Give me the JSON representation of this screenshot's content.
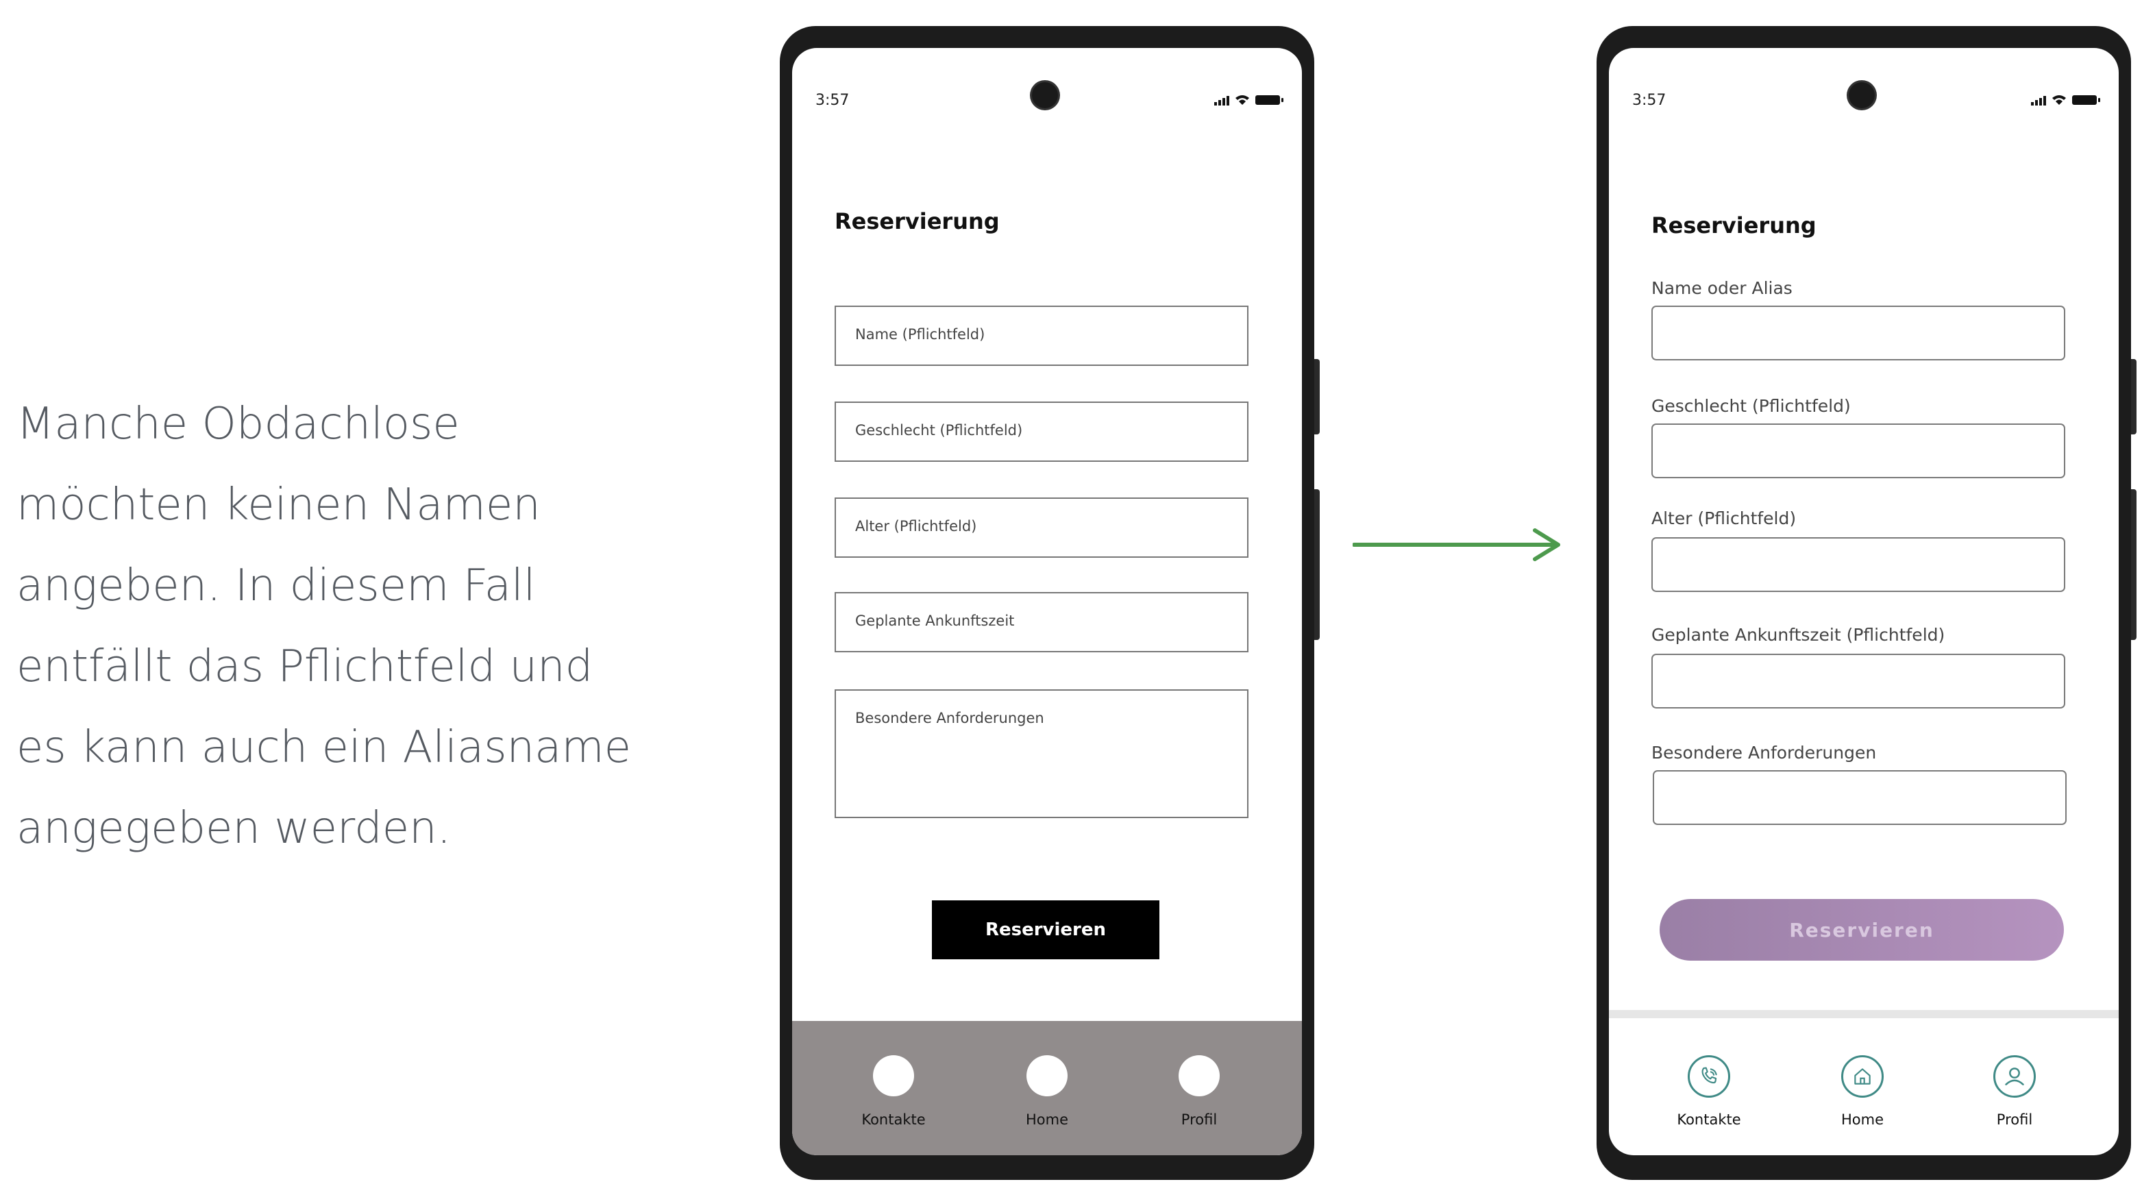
{
  "caption": {
    "lines": [
      "Manche Obdachlose",
      "möchten keinen Namen",
      "angeben. In diesem Fall",
      "entfällt das Pflichtfeld und",
      "es kann auch ein Aliasname",
      "angegeben werden."
    ]
  },
  "colors": {
    "arrow": "#4d9a4d",
    "accent_teal": "#3f8a86",
    "button_purple": "#a98ab5"
  },
  "phone_before": {
    "time": "3:57",
    "title": "Reservierung",
    "fields": [
      "Name (Pflichtfeld)",
      "Geschlecht (Pflichtfeld)",
      "Alter (Pflichtfeld)",
      "Geplante Ankunftszeit",
      "Besondere Anforderungen"
    ],
    "button": "Reservieren",
    "nav": [
      "Kontakte",
      "Home",
      "Profil"
    ]
  },
  "phone_after": {
    "time": "3:57",
    "title": "Reservierung",
    "fields": [
      "Name oder Alias",
      "Geschlecht (Pflichtfeld)",
      "Alter (Pflichtfeld)",
      "Geplante Ankunftszeit (Pflichtfeld)",
      "Besondere Anforderungen"
    ],
    "button": "Reservieren",
    "nav": [
      {
        "label": "Kontakte",
        "icon": "phone-icon"
      },
      {
        "label": "Home",
        "icon": "home-icon"
      },
      {
        "label": "Profil",
        "icon": "user-icon"
      }
    ]
  }
}
